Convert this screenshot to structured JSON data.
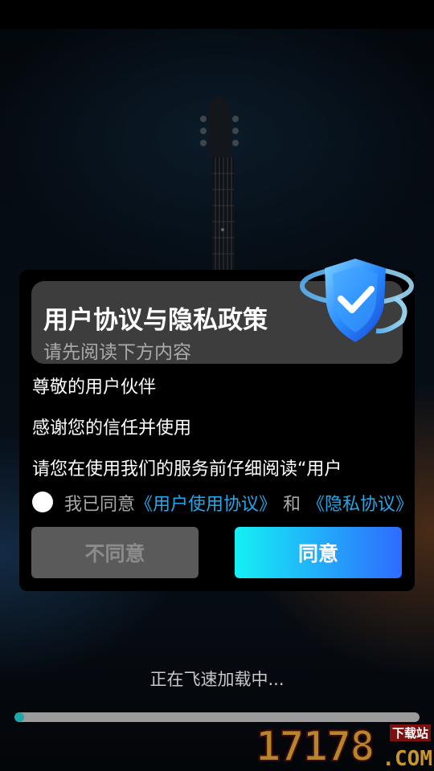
{
  "dialog": {
    "title": "用户协议与隐私政策",
    "subtitle": "请先阅读下方内容",
    "paragraphs": [
      "尊敬的用户伙伴",
      "感谢您的信任并使用",
      "请您在使用我们的服务前仔细阅读“用户"
    ],
    "agree": {
      "prefix": "我已同意",
      "user_agreement_link": "《用户使用协议》",
      "and": "和",
      "privacy_link": "《隐私协议》"
    },
    "disagree_label": "不同意",
    "agree_label": "同意"
  },
  "loading": {
    "text": "正在飞速加载中...",
    "progress": 0.02
  },
  "watermark": {
    "number": "17178",
    "subtitle": "下载站",
    "domain": ".COM"
  },
  "colors": {
    "link": "#22a7ea",
    "agree_gradient_start": "#14f0f4",
    "agree_gradient_end": "#2f6bff",
    "progress_fill": "#1ea6a8"
  }
}
